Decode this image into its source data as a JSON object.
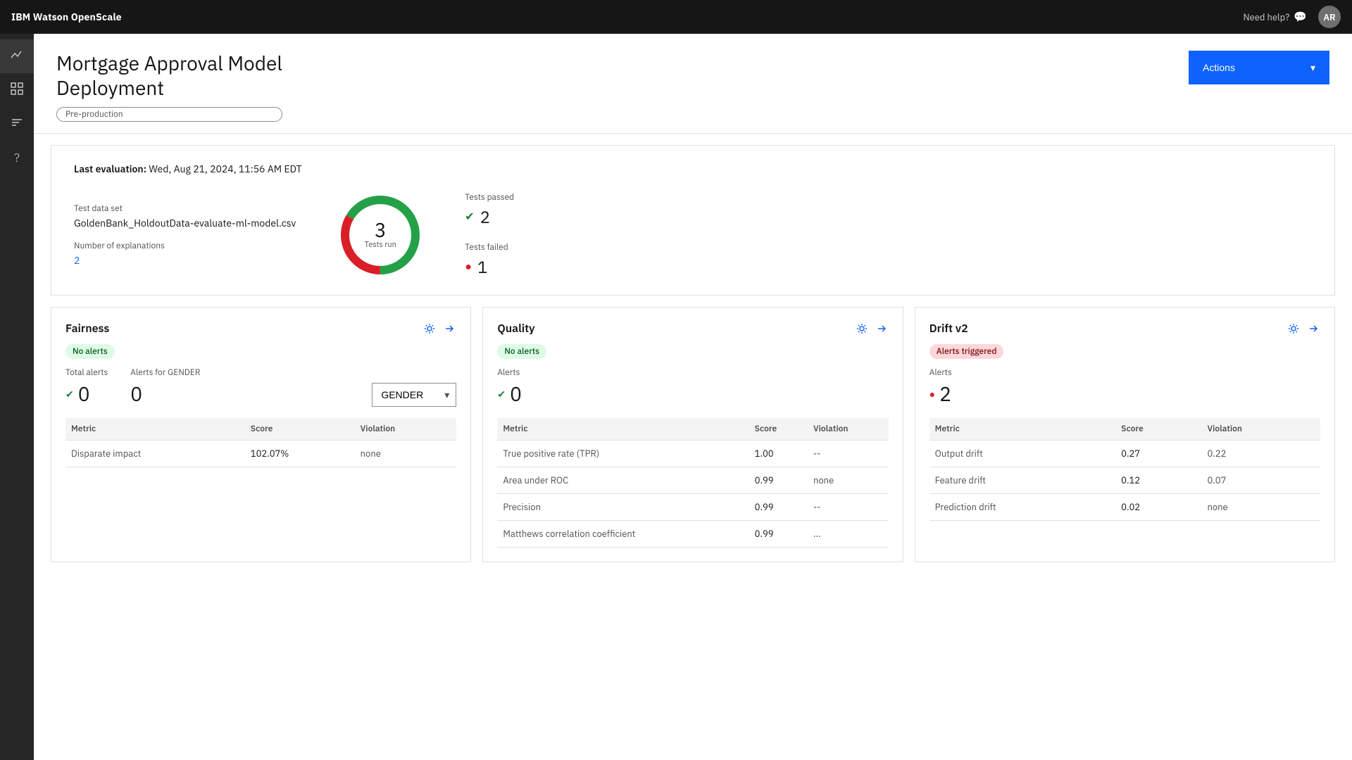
{
  "topbar": {
    "logo": "IBM Watson OpenScale",
    "help_label": "Need help?",
    "avatar_initials": "AR"
  },
  "sidebar": {
    "items": [
      {
        "id": "analytics",
        "icon": "∿",
        "active": true
      },
      {
        "id": "grid",
        "icon": "⊞",
        "active": false
      },
      {
        "id": "filters",
        "icon": "⇄",
        "active": false
      },
      {
        "id": "help",
        "icon": "?",
        "active": false
      }
    ]
  },
  "page": {
    "title_line1": "Mortgage Approval Model",
    "title_line2": "Deployment",
    "badge": "Pre-production",
    "actions_label": "Actions"
  },
  "evaluation": {
    "last_eval_label": "Last evaluation:",
    "last_eval_date": "Wed, Aug 21, 2024, 11:56 AM EDT",
    "test_data_label": "Test data set",
    "test_data_value": "GoldenBank_HoldoutData-evaluate-ml-model.csv",
    "explanations_label": "Number of explanations",
    "explanations_value": "2",
    "donut": {
      "number": "3",
      "label": "Tests run",
      "passed": 2,
      "failed": 1,
      "total": 3
    },
    "tests_passed_label": "Tests passed",
    "tests_passed_count": "2",
    "tests_failed_label": "Tests failed",
    "tests_failed_count": "1"
  },
  "cards": [
    {
      "id": "fairness",
      "title": "Fairness",
      "alert_status": "No alerts",
      "alert_status_type": "green",
      "total_alerts_label": "Total alerts",
      "total_alerts_value": "0",
      "gender_alerts_label": "Alerts for GENDER",
      "gender_alerts_value": "0",
      "dropdown_value": "GENDER",
      "alerts_label": null,
      "alerts_value": null,
      "table_headers": [
        "Metric",
        "Score",
        "Violation"
      ],
      "table_rows": [
        {
          "metric": "Disparate impact",
          "score": "102.07%",
          "violation": "none"
        }
      ]
    },
    {
      "id": "quality",
      "title": "Quality",
      "alert_status": "No alerts",
      "alert_status_type": "green",
      "total_alerts_label": null,
      "total_alerts_value": null,
      "gender_alerts_label": null,
      "gender_alerts_value": null,
      "dropdown_value": null,
      "alerts_label": "Alerts",
      "alerts_value": "0",
      "table_headers": [
        "Metric",
        "Score",
        "Violation"
      ],
      "table_rows": [
        {
          "metric": "True positive rate (TPR)",
          "score": "1.00",
          "violation": "--"
        },
        {
          "metric": "Area under ROC",
          "score": "0.99",
          "violation": "none"
        },
        {
          "metric": "Precision",
          "score": "0.99",
          "violation": "--"
        },
        {
          "metric": "Matthews correlation coefficient",
          "score": "0.99",
          "violation": "..."
        }
      ]
    },
    {
      "id": "drift",
      "title": "Drift v2",
      "alert_status": "Alerts triggered",
      "alert_status_type": "pink",
      "total_alerts_label": null,
      "total_alerts_value": null,
      "gender_alerts_label": null,
      "gender_alerts_value": null,
      "dropdown_value": null,
      "alerts_label": "Alerts",
      "alerts_value": "2",
      "table_headers": [
        "Metric",
        "Score",
        "Violation"
      ],
      "table_rows": [
        {
          "metric": "Output drift",
          "score": "0.27",
          "violation": "0.22"
        },
        {
          "metric": "Feature drift",
          "score": "0.12",
          "violation": "0.07"
        },
        {
          "metric": "Prediction drift",
          "score": "0.02",
          "violation": "none"
        }
      ]
    }
  ]
}
